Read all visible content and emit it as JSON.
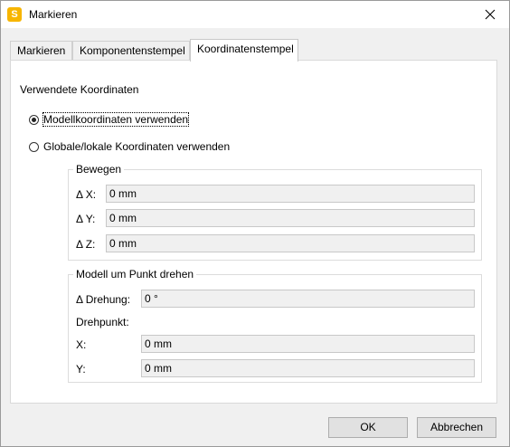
{
  "window": {
    "title": "Markieren",
    "app_icon_letter": "S"
  },
  "tabs": [
    {
      "label": "Markieren"
    },
    {
      "label": "Komponentenstempel"
    },
    {
      "label": "Koordinatenstempel"
    }
  ],
  "coords": {
    "section_label": "Verwendete Koordinaten",
    "option_model": "Modellkoordinaten verwenden",
    "option_global": "Globale/lokale Koordinaten verwenden",
    "selected": "model"
  },
  "move": {
    "title": "Bewegen",
    "dx_label": "Δ X:",
    "dx_value": "0 mm",
    "dy_label": "Δ Y:",
    "dy_value": "0 mm",
    "dz_label": "Δ Z:",
    "dz_value": "0 mm"
  },
  "rotate": {
    "title": "Modell um Punkt drehen",
    "rotation_label": "Δ Drehung:",
    "rotation_value": "0 °",
    "pivot_label": "Drehpunkt:",
    "x_label": "X:",
    "x_value": "0 mm",
    "y_label": "Y:",
    "y_value": "0 mm"
  },
  "buttons": {
    "ok": "OK",
    "cancel": "Abbrechen"
  }
}
